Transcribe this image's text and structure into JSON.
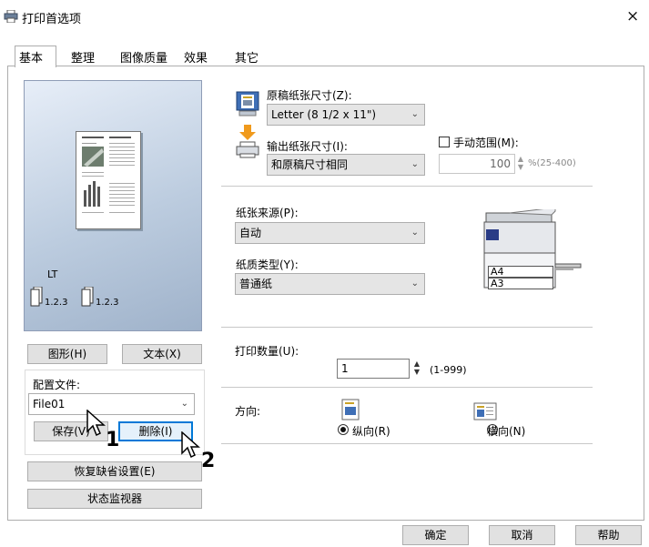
{
  "window": {
    "title": "打印首选项",
    "close_glyph": "×"
  },
  "tabs": [
    {
      "label": "基本",
      "active": true
    },
    {
      "label": "整理",
      "active": false
    },
    {
      "label": "图像质量",
      "active": false
    },
    {
      "label": "效果",
      "active": false
    },
    {
      "label": "其它",
      "active": false
    }
  ],
  "preview": {
    "paper_label": "LT",
    "page_range_1": "1.2.3",
    "page_range_2": "1.2.3"
  },
  "left": {
    "graphics_button": "图形(H)",
    "text_button": "文本(X)",
    "profile_label": "配置文件:",
    "profile_value": "File01",
    "save_button": "保存(V)",
    "delete_button": "删除(I)",
    "restore_defaults_button": "恢复缺省设置(E)",
    "status_monitor_button": "状态监视器"
  },
  "right": {
    "original_size_label": "原稿纸张尺寸(Z):",
    "original_size_value": "Letter (8 1/2 x 11\")",
    "output_size_label": "输出纸张尺寸(I):",
    "output_size_value": "和原稿尺寸相同",
    "manual_zoom_label": "手动范围(M):",
    "zoom_value": "100",
    "zoom_range": "%(25-400)",
    "paper_source_label": "纸张来源(P):",
    "paper_source_value": "自动",
    "paper_type_label": "纸质类型(Y):",
    "paper_type_value": "普通纸",
    "tray_a4": "A4",
    "tray_a3": "A3",
    "copies_label": "打印数量(U):",
    "copies_value": "1",
    "copies_range": "(1-999)",
    "orientation_label": "方向:",
    "portrait_label": "纵向(R)",
    "landscape_label": "横向(N)",
    "orientation_selected": "portrait"
  },
  "annotations": {
    "marker_1": "1",
    "marker_2": "2"
  },
  "footer": {
    "ok": "确定",
    "cancel": "取消",
    "help": "帮助"
  },
  "colors": {
    "accent": "#0078d7",
    "button_face": "#e1e1e1",
    "preview_bg": "#bcccdf"
  }
}
